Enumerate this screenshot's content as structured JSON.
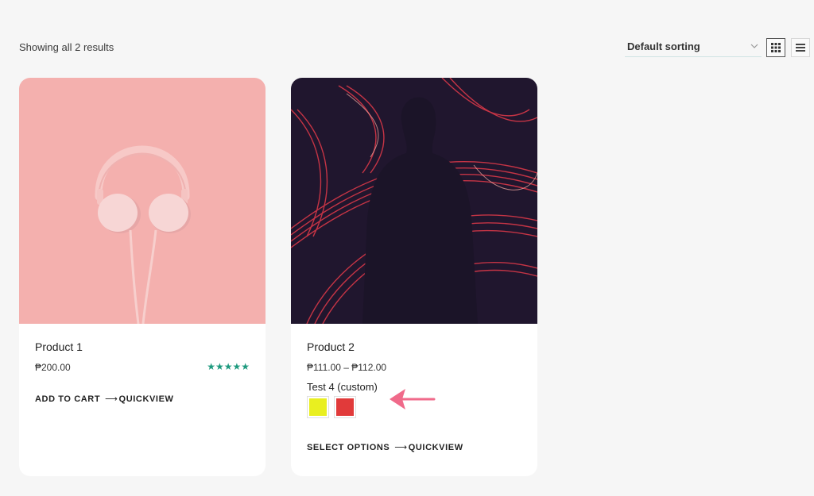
{
  "toolbar": {
    "result_count": "Showing all 2 results",
    "sorting_selected": "Default sorting",
    "views": [
      {
        "name": "grid-view",
        "icon": "grid-icon",
        "active": true
      },
      {
        "name": "list-view",
        "icon": "list-icon",
        "active": false
      }
    ]
  },
  "products": [
    {
      "title": "Product 1",
      "price": "₱200.00",
      "rating": 5,
      "rating_stars": "★★★★★",
      "primary_action": "ADD TO CART",
      "quickview": "QUICKVIEW",
      "image_icon": "headphones-image"
    },
    {
      "title": "Product 2",
      "price": "₱111.00 – ₱112.00",
      "attribute_label": "Test 4 (custom)",
      "swatches": [
        {
          "name": "yellow",
          "color": "#e9ef20"
        },
        {
          "name": "red",
          "color": "#e13a3a"
        }
      ],
      "primary_action": "SELECT OPTIONS",
      "quickview": "QUICKVIEW",
      "image_icon": "light-painting-silhouette-image"
    }
  ],
  "colors": {
    "background": "#f6f6f6",
    "card": "#ffffff",
    "stars": "#1d9a7e",
    "callout_arrow": "#f06a8a"
  }
}
